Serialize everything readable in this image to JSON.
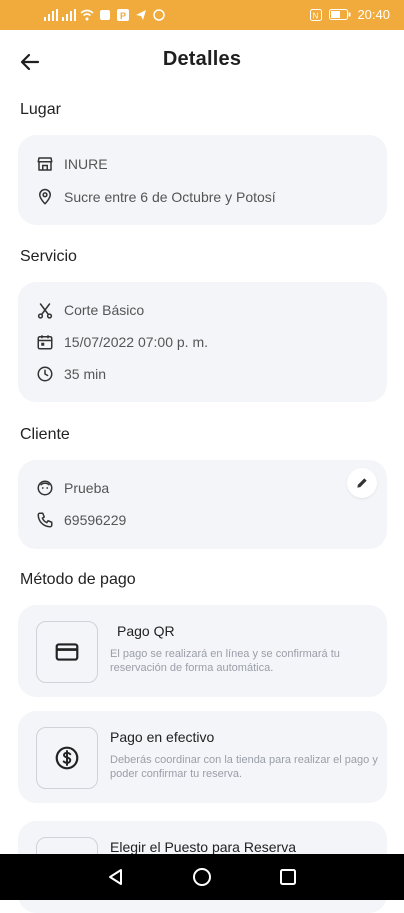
{
  "status_bar": {
    "time": "20:40"
  },
  "header": {
    "title": "Detalles"
  },
  "lugar": {
    "title": "Lugar",
    "name": "INURE",
    "address": "Sucre entre 6 de Octubre y Potosí"
  },
  "servicio": {
    "title": "Servicio",
    "name": "Corte Básico",
    "datetime": "15/07/2022 07:00 p. m.",
    "duration": "35 min"
  },
  "cliente": {
    "title": "Cliente",
    "name": "Prueba",
    "phone": "69596229"
  },
  "pago": {
    "title": "Método de pago",
    "options": [
      {
        "title": "Pago QR",
        "description": "El pago se realizará en línea y se confirmará tu reservación de forma automática."
      },
      {
        "title": "Pago en efectivo",
        "description": "Deberás coordinar con la tienda para realizar el pago y poder confirmar tu reserva."
      },
      {
        "title": "Elegir el Puesto para Reserva",
        "description": ""
      }
    ]
  },
  "colors": {
    "status_bar": "#f0ab3c",
    "card_bg": "#f4f5f9",
    "nav_bar": "#000000"
  }
}
